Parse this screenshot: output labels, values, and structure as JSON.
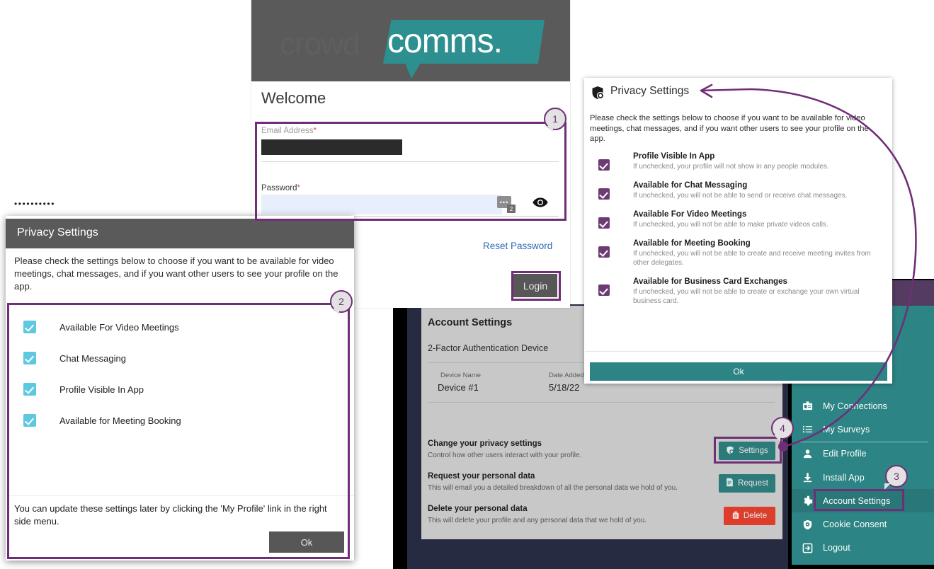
{
  "login": {
    "logo_text_back": "crowd",
    "logo_text_front": "comms.",
    "heading": "Welcome",
    "email_label": "Email Address",
    "email_value": "",
    "password_label": "Password",
    "password_value": "••••••••••",
    "password_manager_badge": "2",
    "password_manager_glyph": "•••",
    "reveal_icon": "eye-icon",
    "reset_link": "Reset Password",
    "login_button": "Login",
    "required_mark": "*"
  },
  "privacy_right": {
    "icon": "privacy-shield-icon",
    "title": "Privacy Settings",
    "intro": "Please check the settings below to choose if you want to be available for video meetings, chat messages, and if you want other users to see your profile on the app.",
    "items": [
      {
        "label": "Profile Visible In App",
        "desc": "If unchecked, your profile will not show in any people modules.",
        "checked": true
      },
      {
        "label": "Available for Chat Messaging",
        "desc": "If unchecked, you will not be able to send or receive chat messages.",
        "checked": true
      },
      {
        "label": "Available For Video Meetings",
        "desc": "If unchecked, you will not be able to make private videos calls.",
        "checked": true
      },
      {
        "label": "Available for Meeting Booking",
        "desc": "If unchecked, you will not be able to create and receive meeting invites from other delegates.",
        "checked": true
      },
      {
        "label": "Available for Business Card Exchanges",
        "desc": "If unchecked, you will not be able to create or exchange your own virtual business card.",
        "checked": true
      }
    ],
    "ok_button": "Ok"
  },
  "privacy_left": {
    "title": "Privacy Settings",
    "intro": "Please check the settings below to choose if you want to be available for video meetings, chat messages, and if you want other users to see your profile on the app.",
    "items": [
      {
        "label": "Available For Video Meetings",
        "checked": true
      },
      {
        "label": "Chat Messaging",
        "checked": true
      },
      {
        "label": "Profile Visible In App",
        "checked": true
      },
      {
        "label": "Available for Meeting Booking",
        "checked": true
      }
    ],
    "note": "You can update these settings later by clicking the 'My Profile' link in the right side menu.",
    "ok_button": "Ok"
  },
  "account_settings": {
    "title": "Account Settings",
    "subtitle": "2-Factor Authentication Device",
    "table": {
      "headers": [
        "Device Name",
        "Date Added"
      ],
      "rows": [
        [
          "Device #1",
          "5/18/22"
        ]
      ]
    },
    "rows": [
      {
        "title": "Change your privacy settings",
        "desc": "Control how other users interact with your profile.",
        "button": "Settings",
        "button_icon": "privacy-shield-icon",
        "button_color": "#2d7a7a"
      },
      {
        "title": "Request your personal data",
        "desc": "This will email you a detailed breakdown of all the personal data we hold of you.",
        "button": "Request",
        "button_icon": "document-icon",
        "button_color": "#2d7a7a"
      },
      {
        "title": "Delete your personal data",
        "desc": "This will delete your profile and any personal data that we hold of you.",
        "button": "Delete",
        "button_icon": "trash-icon",
        "button_color": "#dd3e2b"
      }
    ]
  },
  "sidebar": {
    "items": [
      {
        "label": "My Connections",
        "icon": "badge-card-icon",
        "active": false
      },
      {
        "label": "My Surveys",
        "icon": "list-icon",
        "active": false
      },
      {
        "label": "Edit Profile",
        "icon": "person-icon",
        "active": false
      },
      {
        "label": "Install App",
        "icon": "download-icon",
        "active": false
      },
      {
        "label": "Account Settings",
        "icon": "gear-icon",
        "active": true
      },
      {
        "label": "Cookie Consent",
        "icon": "cookie-shield-icon",
        "active": false
      },
      {
        "label": "Logout",
        "icon": "logout-icon",
        "active": false
      }
    ]
  },
  "annotations": {
    "callouts": [
      "1",
      "2",
      "3",
      "4"
    ],
    "highlight_color": "#702e78"
  },
  "colors": {
    "teal": "#2d8484",
    "purple_accent": "#702e78",
    "purple_header": "#533b61",
    "checkbox_dark_purple": "#6d3a72",
    "checkbox_cyan": "#5ec8e0",
    "delete_red": "#dd3e2b",
    "navy_backdrop": "#262b42",
    "gray_header": "#5a5a5a"
  }
}
